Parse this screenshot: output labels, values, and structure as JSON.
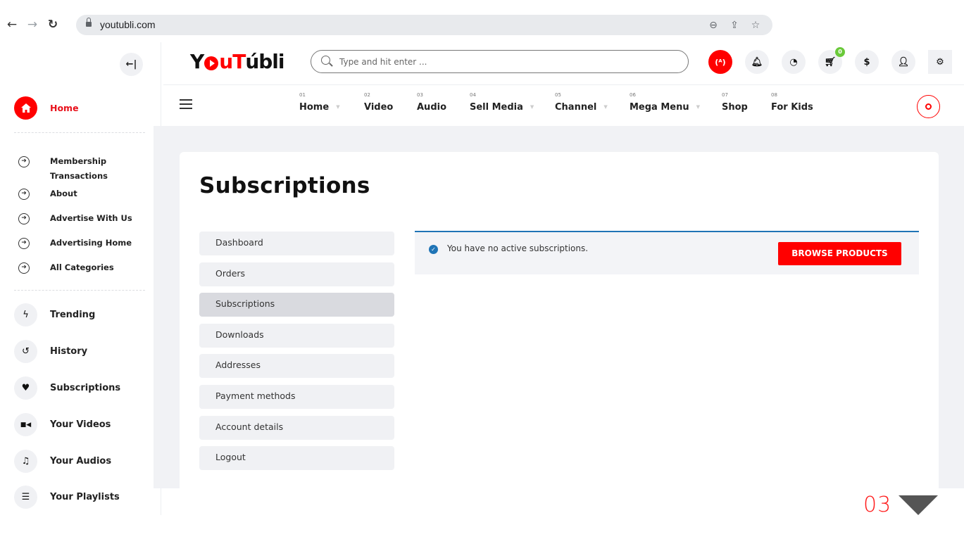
{
  "browser": {
    "url": "youtubli.com",
    "icons": [
      "back-arrow-icon",
      "forward-arrow-icon",
      "reload-icon",
      "lock-icon",
      "zoom-out-icon",
      "share-icon",
      "bookmark-star-icon"
    ]
  },
  "header": {
    "logo": {
      "y": "Y",
      "u": "u",
      "t": "T",
      "rest": "úbli"
    },
    "search_placeholder": "Type and hit enter ...",
    "cart_count": "0",
    "icons": [
      "live-broadcast-icon",
      "bell-icon",
      "clock-icon",
      "cart-icon",
      "dollar-icon",
      "user-shield-icon",
      "gear-icon"
    ],
    "accent_color": "#ff0000"
  },
  "mainnav": {
    "items": [
      {
        "num": "01",
        "label": "Home",
        "has_dropdown": true
      },
      {
        "num": "02",
        "label": "Video",
        "has_dropdown": false
      },
      {
        "num": "03",
        "label": "Audio",
        "has_dropdown": false
      },
      {
        "num": "04",
        "label": "Sell Media",
        "has_dropdown": true
      },
      {
        "num": "05",
        "label": "Channel",
        "has_dropdown": true
      },
      {
        "num": "06",
        "label": "Mega Menu",
        "has_dropdown": true
      },
      {
        "num": "07",
        "label": "Shop",
        "has_dropdown": false
      },
      {
        "num": "08",
        "label": "For Kids",
        "has_dropdown": false
      }
    ],
    "caret": "▼"
  },
  "sidebar": {
    "home": {
      "label": "Home",
      "icon": "home-icon"
    },
    "links": [
      {
        "label": "Membership Transactions"
      },
      {
        "label": "About"
      },
      {
        "label": "Advertise With Us"
      },
      {
        "label": "Advertising Home"
      },
      {
        "label": "All Categories"
      }
    ],
    "items": [
      {
        "label": "Trending",
        "icon": "lightning-icon",
        "glyph": "ϟ"
      },
      {
        "label": "History",
        "icon": "history-icon",
        "glyph": "↺"
      },
      {
        "label": "Subscriptions",
        "icon": "heart-icon",
        "glyph": "♥"
      },
      {
        "label": "Your Videos",
        "icon": "video-camera-icon",
        "glyph": "■◀"
      },
      {
        "label": "Your Audios",
        "icon": "music-icon",
        "glyph": "♫"
      },
      {
        "label": "Your Playlists",
        "icon": "list-icon",
        "glyph": "☰"
      }
    ]
  },
  "page": {
    "title": "Subscriptions",
    "account_nav": [
      {
        "label": "Dashboard",
        "active": false
      },
      {
        "label": "Orders",
        "active": false
      },
      {
        "label": "Subscriptions",
        "active": true
      },
      {
        "label": "Downloads",
        "active": false
      },
      {
        "label": "Addresses",
        "active": false
      },
      {
        "label": "Payment methods",
        "active": false
      },
      {
        "label": "Account details",
        "active": false
      },
      {
        "label": "Logout",
        "active": false
      }
    ],
    "notice": {
      "message": "You have no active subscriptions.",
      "button": "BROWSE PRODUCTS",
      "border_color": "#1f74b6"
    }
  },
  "slide_indicator": {
    "number": "03"
  }
}
